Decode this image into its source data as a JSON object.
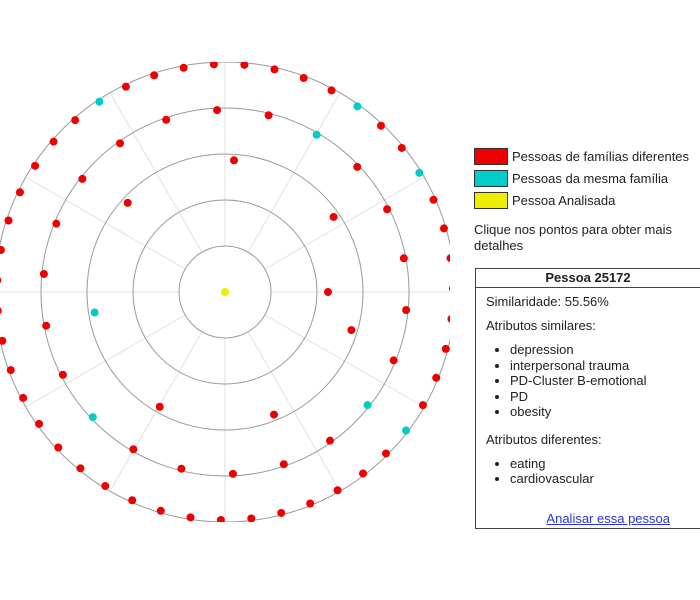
{
  "legend": {
    "items": [
      {
        "label": "Pessoas de famílias diferentes",
        "color": "#ee0000"
      },
      {
        "label": "Pessoas da mesma família",
        "color": "#00cccc"
      },
      {
        "label": "Pessoa Analisada",
        "color": "#eeee00"
      }
    ]
  },
  "hint": "Clique nos pontos para obter mais detalhes",
  "panel": {
    "title": "Pessoa 25172",
    "similarity": "Similaridade: 55.56%",
    "similar_heading": "Atributos similares:",
    "similar_attributes": [
      "depression",
      "interpersonal trauma",
      "PD-Cluster B-emotional",
      "PD",
      "obesity"
    ],
    "different_heading": "Atributos diferentes:",
    "different_attributes": [
      "eating",
      "cardiovascular"
    ],
    "link_label": "Analisar essa pessoa"
  },
  "rings": {
    "count": 4,
    "spokes": 12,
    "colors": {
      "different": "#ee0000",
      "same": "#00cccc",
      "analyzed": "#eeee00"
    },
    "ring1": {
      "points": [
        {
          "type": "different"
        }
      ]
    },
    "ring2": {
      "points": [
        {
          "type": "different"
        },
        {
          "type": "different"
        },
        {
          "type": "different"
        },
        {
          "type": "different"
        },
        {
          "type": "different"
        },
        {
          "type": "different"
        },
        {
          "type": "same"
        }
      ]
    },
    "ring3": {
      "points": [
        {
          "type": "different"
        },
        {
          "type": "different"
        },
        {
          "type": "different"
        },
        {
          "type": "same"
        },
        {
          "type": "different"
        },
        {
          "type": "different"
        },
        {
          "type": "different"
        },
        {
          "type": "different"
        },
        {
          "type": "different"
        },
        {
          "type": "same"
        },
        {
          "type": "different"
        },
        {
          "type": "different"
        },
        {
          "type": "different"
        },
        {
          "type": "different"
        },
        {
          "type": "different"
        },
        {
          "type": "same"
        },
        {
          "type": "different"
        },
        {
          "type": "different"
        },
        {
          "type": "different"
        },
        {
          "type": "different"
        },
        {
          "type": "different"
        },
        {
          "type": "different"
        }
      ]
    },
    "ring4": {
      "points": [
        {
          "type": "same"
        },
        {
          "type": "different"
        },
        {
          "type": "different"
        },
        {
          "type": "different"
        },
        {
          "type": "different"
        },
        {
          "type": "different"
        },
        {
          "type": "different"
        },
        {
          "type": "different"
        },
        {
          "type": "different"
        },
        {
          "type": "same"
        },
        {
          "type": "different"
        },
        {
          "type": "different"
        },
        {
          "type": "different"
        },
        {
          "type": "different"
        },
        {
          "type": "different"
        },
        {
          "type": "different"
        },
        {
          "type": "different"
        },
        {
          "type": "different"
        },
        {
          "type": "different"
        },
        {
          "type": "different"
        },
        {
          "type": "different"
        },
        {
          "type": "different"
        },
        {
          "type": "different"
        },
        {
          "type": "different"
        },
        {
          "type": "different"
        },
        {
          "type": "different"
        },
        {
          "type": "different"
        },
        {
          "type": "different"
        },
        {
          "type": "different"
        },
        {
          "type": "different"
        },
        {
          "type": "different"
        },
        {
          "type": "different"
        },
        {
          "type": "different"
        },
        {
          "type": "different"
        },
        {
          "type": "different"
        },
        {
          "type": "same"
        },
        {
          "type": "different"
        },
        {
          "type": "different"
        },
        {
          "type": "different"
        },
        {
          "type": "different"
        },
        {
          "type": "different"
        },
        {
          "type": "different"
        },
        {
          "type": "different"
        },
        {
          "type": "different"
        },
        {
          "type": "same"
        },
        {
          "type": "different"
        },
        {
          "type": "different"
        }
      ]
    }
  }
}
